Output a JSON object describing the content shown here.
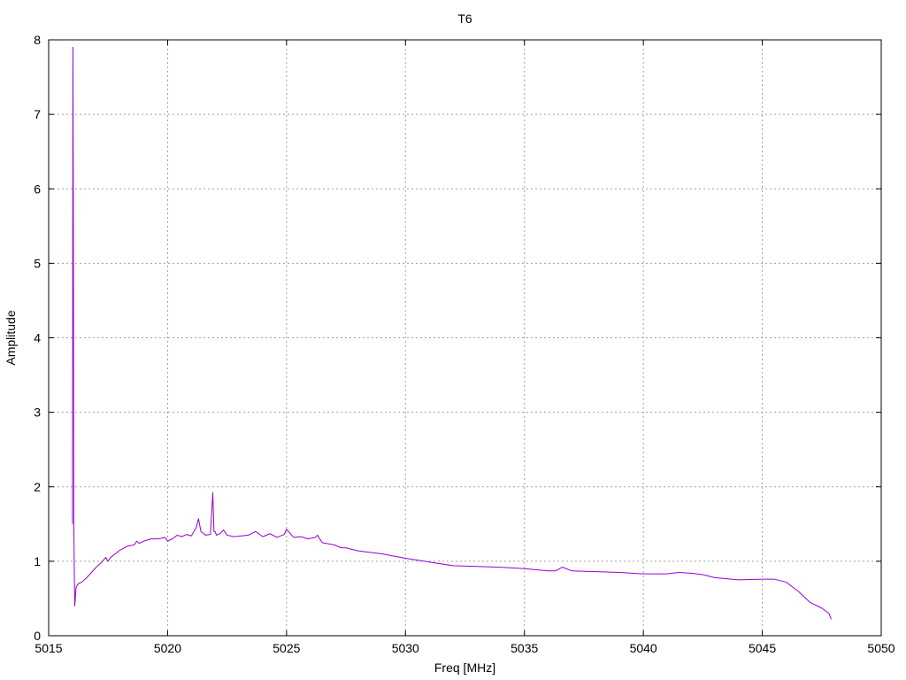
{
  "chart_data": {
    "type": "line",
    "title": "T6",
    "xlabel": "Freq [MHz]",
    "ylabel": "Amplitude",
    "xlim": [
      5015,
      5050
    ],
    "ylim": [
      0,
      8
    ],
    "xticks": [
      5015,
      5020,
      5025,
      5030,
      5035,
      5040,
      5045,
      5050
    ],
    "yticks": [
      0,
      1,
      2,
      3,
      4,
      5,
      6,
      7,
      8
    ],
    "grid": true,
    "legend": "none",
    "series": [
      {
        "color": "#9400d3",
        "x": [
          5016.0,
          5016.02,
          5016.04,
          5016.06,
          5016.08,
          5016.1,
          5016.15,
          5016.25,
          5016.4,
          5016.6,
          5016.8,
          5017.0,
          5017.2,
          5017.4,
          5017.5,
          5017.6,
          5017.8,
          5018.0,
          5018.3,
          5018.6,
          5018.7,
          5018.8,
          5019.0,
          5019.3,
          5019.6,
          5019.9,
          5020.0,
          5020.2,
          5020.4,
          5020.6,
          5020.8,
          5021.0,
          5021.2,
          5021.3,
          5021.4,
          5021.6,
          5021.8,
          5021.9,
          5021.95,
          5022.0,
          5022.05,
          5022.2,
          5022.35,
          5022.5,
          5022.8,
          5023.1,
          5023.4,
          5023.7,
          5024.0,
          5024.3,
          5024.6,
          5024.9,
          5025.0,
          5025.3,
          5025.6,
          5025.9,
          5026.2,
          5026.3,
          5026.5,
          5027.0,
          5027.3,
          5027.5,
          5028.0,
          5029.0,
          5030.0,
          5031.0,
          5032.0,
          5033.0,
          5034.0,
          5035.0,
          5036.0,
          5036.3,
          5036.6,
          5037.0,
          5038.0,
          5039.0,
          5040.0,
          5041.0,
          5041.5,
          5042.0,
          5042.5,
          5043.0,
          5044.0,
          5045.0,
          5045.5,
          5046.0,
          5046.5,
          5047.0,
          5047.5,
          5047.8,
          5047.9
        ],
        "values": [
          1.5,
          7.9,
          5.2,
          1.45,
          0.8,
          0.4,
          0.65,
          0.7,
          0.72,
          0.78,
          0.85,
          0.92,
          0.98,
          1.05,
          1.0,
          1.05,
          1.1,
          1.15,
          1.2,
          1.22,
          1.27,
          1.24,
          1.27,
          1.3,
          1.3,
          1.32,
          1.27,
          1.3,
          1.35,
          1.33,
          1.36,
          1.34,
          1.45,
          1.57,
          1.4,
          1.35,
          1.36,
          1.92,
          1.4,
          1.4,
          1.35,
          1.37,
          1.42,
          1.35,
          1.33,
          1.34,
          1.35,
          1.4,
          1.33,
          1.37,
          1.32,
          1.36,
          1.43,
          1.32,
          1.33,
          1.3,
          1.32,
          1.35,
          1.25,
          1.22,
          1.18,
          1.18,
          1.14,
          1.1,
          1.04,
          0.99,
          0.94,
          0.93,
          0.92,
          0.9,
          0.87,
          0.87,
          0.92,
          0.87,
          0.86,
          0.85,
          0.83,
          0.83,
          0.85,
          0.84,
          0.82,
          0.78,
          0.75,
          0.76,
          0.76,
          0.72,
          0.6,
          0.45,
          0.37,
          0.3,
          0.22
        ]
      }
    ]
  }
}
